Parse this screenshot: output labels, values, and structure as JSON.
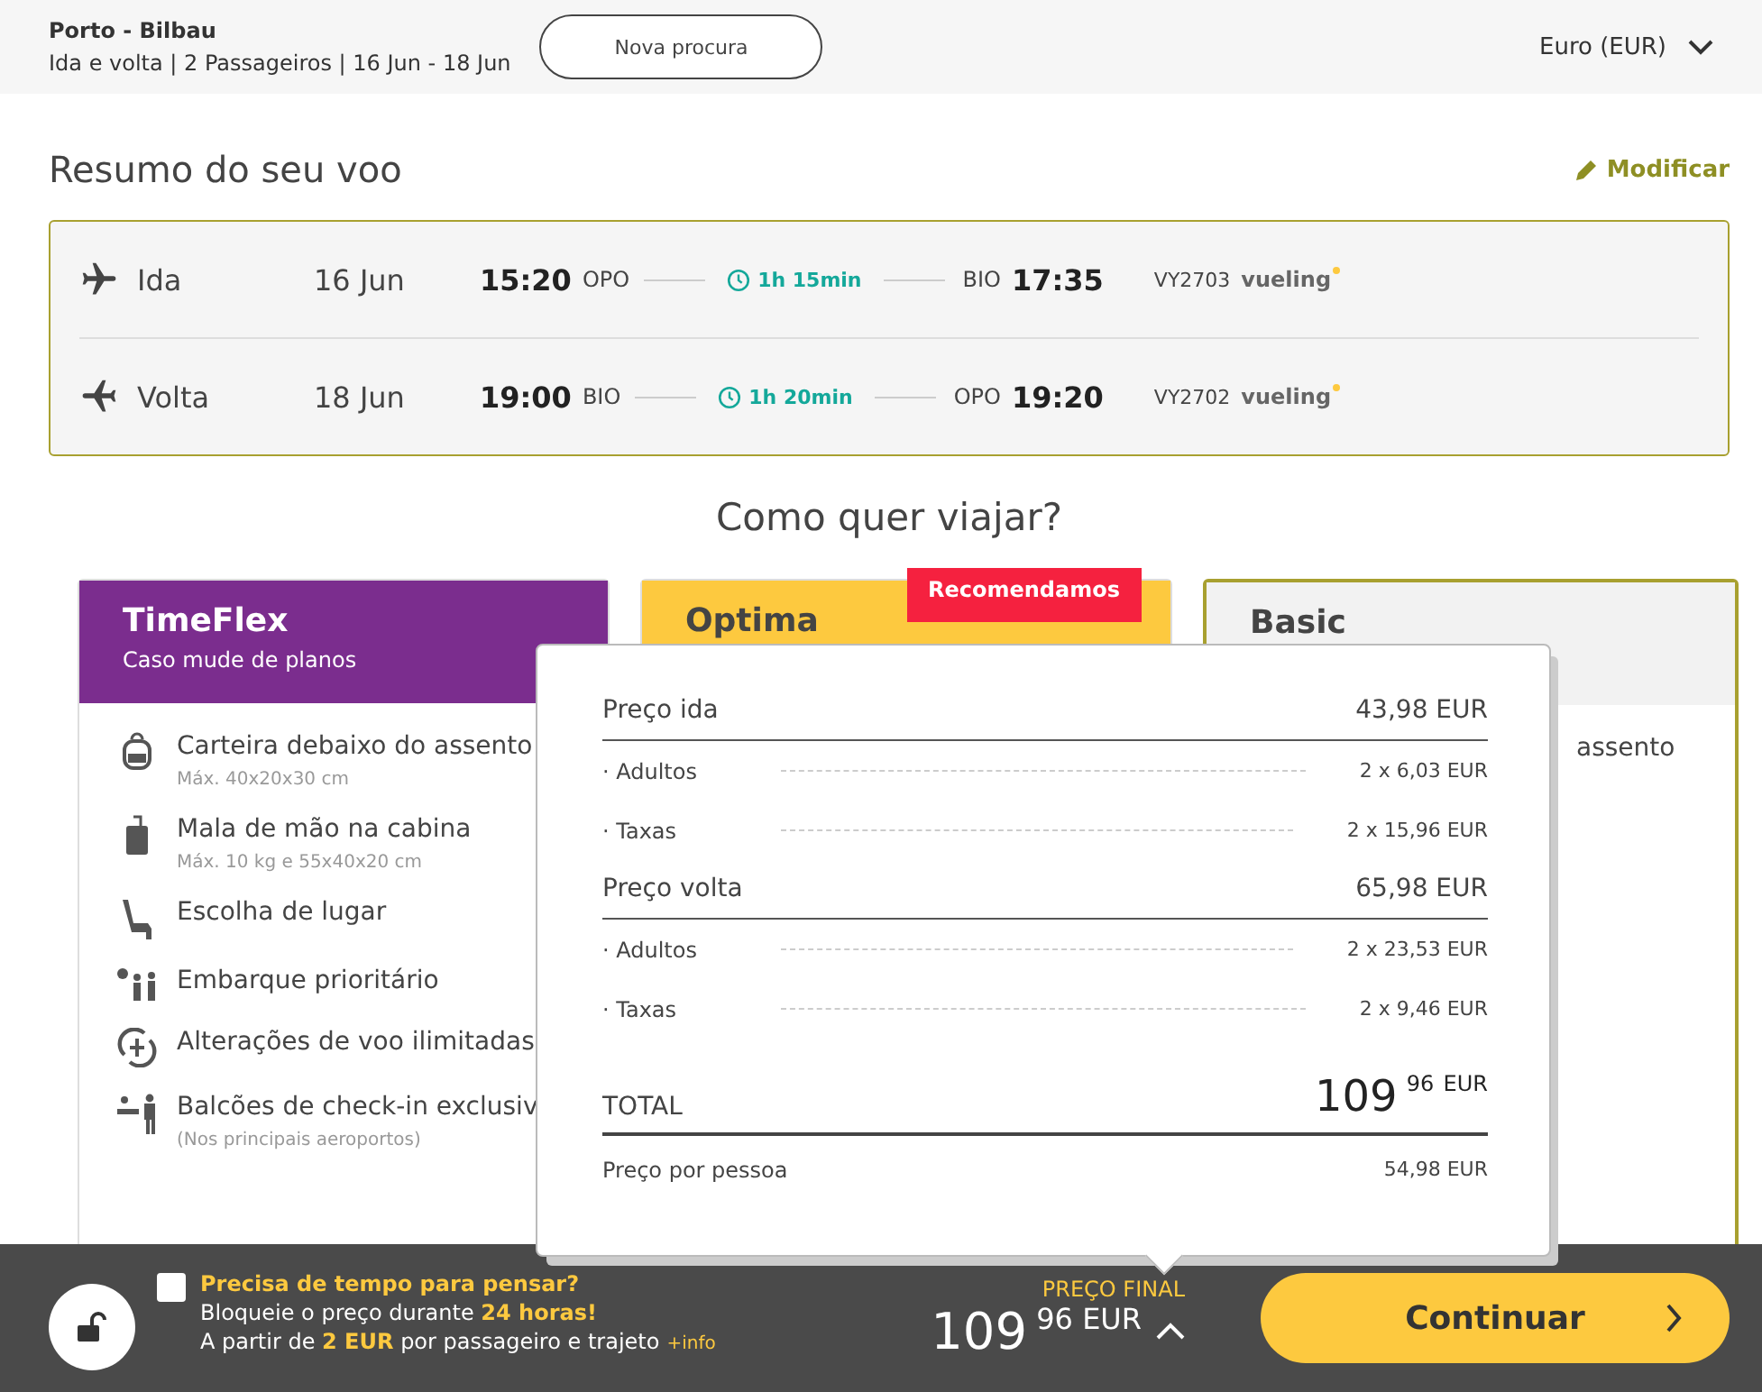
{
  "header": {
    "route": "Porto - Bilbau",
    "details": "Ida e volta | 2 Passageiros | 16 Jun - 18 Jun",
    "new_search_button": "Nova procura",
    "currency": "Euro (EUR)"
  },
  "summary": {
    "title": "Resumo do seu voo",
    "modify_link": "Modificar"
  },
  "flights": [
    {
      "kind": "outbound",
      "direction": "Ida",
      "date": "16 Jun",
      "dep_time": "15:20",
      "dep_code": "OPO",
      "duration": "1h 15min",
      "arr_code": "BIO",
      "arr_time": "17:35",
      "flight_no": "VY2703",
      "airline": "vueling"
    },
    {
      "kind": "return",
      "direction": "Volta",
      "date": "18 Jun",
      "dep_time": "19:00",
      "dep_code": "BIO",
      "duration": "1h 20min",
      "arr_code": "OPO",
      "arr_time": "19:20",
      "flight_no": "VY2702",
      "airline": "vueling"
    }
  ],
  "fares_title": "Como quer viajar?",
  "fares": [
    {
      "name": "TimeFlex",
      "subtitle": "Caso mude de planos",
      "color": "#7b2d8e",
      "selected": false,
      "features": [
        {
          "kind": "bag",
          "text": "Carteira debaixo do assento",
          "note": "Máx. 40x20x30 cm"
        },
        {
          "kind": "suitcase",
          "text": "Mala de mão na cabina",
          "note": "Máx. 10 kg e 55x40x20 cm"
        },
        {
          "kind": "seat",
          "text": "Escolha de lugar"
        },
        {
          "kind": "boarding",
          "text": "Embarque prioritário"
        },
        {
          "kind": "changes",
          "text": "Alterações de voo ilimitadas"
        },
        {
          "kind": "checkin",
          "text": "Balcões de check-in exclusiv",
          "note": "(Nos principais aeroportos)"
        }
      ]
    },
    {
      "name": "Optima",
      "badge": "Recomendamos",
      "color": "#fdc93f",
      "selected": false
    },
    {
      "name": "Basic",
      "color": "#f2f2f2",
      "selected": true,
      "features": [
        {
          "text": "assento"
        }
      ]
    }
  ],
  "price_popup": {
    "sections": [
      {
        "label": "Preço ida",
        "amount": "43,98 EUR",
        "items": [
          {
            "label": "· Adultos",
            "value": "2 x 6,03 EUR"
          },
          {
            "label": "· Taxas",
            "value": "2 x 15,96 EUR"
          }
        ]
      },
      {
        "label": "Preço volta",
        "amount": "65,98 EUR",
        "items": [
          {
            "label": "· Adultos",
            "value": "2 x 23,53 EUR"
          },
          {
            "label": "· Taxas",
            "value": "2 x 9,46 EUR"
          }
        ]
      }
    ],
    "total": {
      "label": "TOTAL",
      "integer": "109",
      "decimals": "96",
      "currency": "EUR"
    },
    "per_person": {
      "label": "Preço por pessoa",
      "value": "54,98 EUR"
    }
  },
  "bottom_bar": {
    "hold_checked": false,
    "hold_title": "Precisa de tempo para pensar?",
    "line1": [
      {
        "text": "Bloqueie o preço durante ",
        "highlight": false
      },
      {
        "text": "24 horas!",
        "highlight": true
      }
    ],
    "line2": [
      {
        "text": "A partir de ",
        "highlight": false
      },
      {
        "text": "2 EUR",
        "highlight": true
      },
      {
        "text": " por passageiro e trajeto",
        "highlight": false
      }
    ],
    "info_link": "+info",
    "final_label": "PREÇO FINAL",
    "price_integer": "109",
    "price_decimals": "96",
    "price_currency": "EUR",
    "breakdown_expanded": true,
    "continue_button": "Continuar"
  }
}
